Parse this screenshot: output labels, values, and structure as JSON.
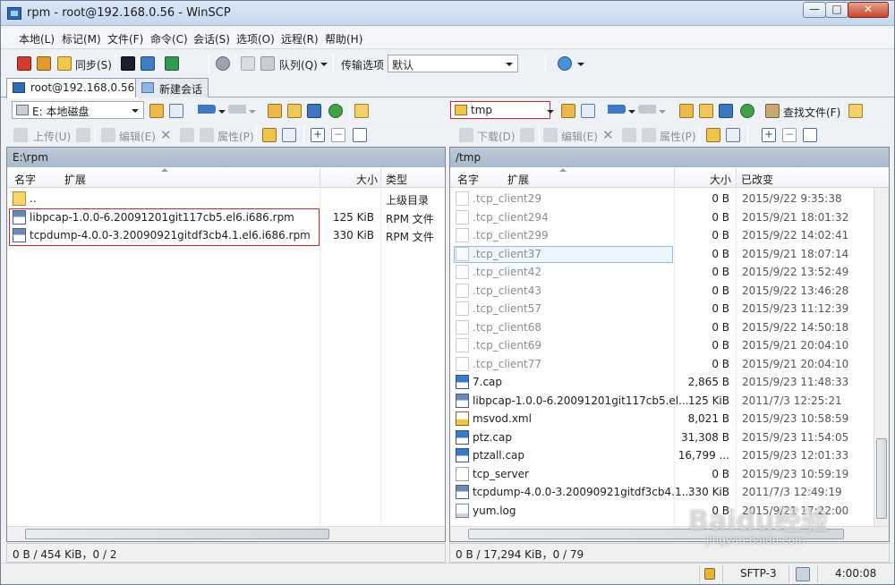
{
  "window": {
    "title": "rpm - root@192.168.0.56 - WinSCP",
    "min": "—",
    "max": "□",
    "close": "✕"
  },
  "menu": [
    "本地(L)",
    "标记(M)",
    "文件(F)",
    "命令(C)",
    "会话(S)",
    "选项(O)",
    "远程(R)",
    "帮助(H)"
  ],
  "toolbar": {
    "sync_label": "同步(S)",
    "queue_label": "队列(Q)",
    "transfer_label": "传输选项",
    "transfer_value": "默认"
  },
  "tabs": [
    {
      "label": "root@192.168.0.56",
      "active": true
    },
    {
      "label": "新建会话",
      "active": false
    }
  ],
  "local": {
    "drive": "E: 本地磁盘",
    "buttons": {
      "upload": "上传(U)",
      "edit": "编辑(E)",
      "props": "属性(P)"
    },
    "path": "E:\\rpm",
    "columns": {
      "name": "名字",
      "ext": "扩展",
      "size": "大小",
      "type": "类型"
    },
    "files": [
      {
        "icon": "up-ico",
        "name": "..",
        "size": "",
        "type": "上级目录"
      },
      {
        "icon": "rpm-ico",
        "name": "libpcap-1.0.0-6.20091201git117cb5.el6.i686.rpm",
        "size": "125 KiB",
        "type": "RPM 文件"
      },
      {
        "icon": "rpm-ico",
        "name": "tcpdump-4.0.0-3.20090921gitdf3cb4.1.el6.i686.rpm",
        "size": "330 KiB",
        "type": "RPM 文件"
      }
    ],
    "status": "0 B / 454 KiB，0 / 2"
  },
  "remote": {
    "dir": "tmp",
    "find_label": "查找文件(F)",
    "buttons": {
      "download": "下载(D)",
      "edit": "编辑(E)",
      "props": "属性(P)"
    },
    "path": "/tmp",
    "columns": {
      "name": "名字",
      "ext": "扩展",
      "size": "大小",
      "changed": "已改变"
    },
    "files": [
      {
        "icon": "file-ico",
        "name": ".tcp_client29",
        "size": "0 B",
        "changed": "2015/9/22 9:35:38",
        "hidden": true
      },
      {
        "icon": "file-ico",
        "name": ".tcp_client294",
        "size": "0 B",
        "changed": "2015/9/21 18:01:32",
        "hidden": true
      },
      {
        "icon": "file-ico",
        "name": ".tcp_client299",
        "size": "0 B",
        "changed": "2015/9/22 14:02:41",
        "hidden": true
      },
      {
        "icon": "file-ico",
        "name": ".tcp_client37",
        "size": "0 B",
        "changed": "2015/9/21 18:07:14",
        "hidden": true
      },
      {
        "icon": "file-ico",
        "name": ".tcp_client42",
        "size": "0 B",
        "changed": "2015/9/22 13:52:49",
        "hidden": true
      },
      {
        "icon": "file-ico",
        "name": ".tcp_client43",
        "size": "0 B",
        "changed": "2015/9/22 13:46:28",
        "hidden": true
      },
      {
        "icon": "file-ico",
        "name": ".tcp_client57",
        "size": "0 B",
        "changed": "2015/9/23 11:12:39",
        "hidden": true
      },
      {
        "icon": "file-ico",
        "name": ".tcp_client68",
        "size": "0 B",
        "changed": "2015/9/22 14:50:18",
        "hidden": true
      },
      {
        "icon": "file-ico",
        "name": ".tcp_client69",
        "size": "0 B",
        "changed": "2015/9/21 20:04:10",
        "hidden": true
      },
      {
        "icon": "file-ico",
        "name": ".tcp_client77",
        "size": "0 B",
        "changed": "2015/9/21 20:04:10",
        "hidden": true
      },
      {
        "icon": "cap-ico",
        "name": "7.cap",
        "size": "2,865 B",
        "changed": "2015/9/23 11:48:33",
        "hidden": false
      },
      {
        "icon": "rpm-ico",
        "name": "libpcap-1.0.0-6.20091201git117cb5.el...",
        "size": "125 KiB",
        "changed": "2011/7/3 12:25:21",
        "hidden": false
      },
      {
        "icon": "xml-ico",
        "name": "msvod.xml",
        "size": "8,021 B",
        "changed": "2015/9/23 10:58:59",
        "hidden": false
      },
      {
        "icon": "cap-ico",
        "name": "ptz.cap",
        "size": "31,308 B",
        "changed": "2015/9/23 11:54:05",
        "hidden": false
      },
      {
        "icon": "cap-ico",
        "name": "ptzall.cap",
        "size": "16,799 ...",
        "changed": "2015/9/23 12:01:33",
        "hidden": false
      },
      {
        "icon": "file-ico",
        "name": "tcp_server",
        "size": "0 B",
        "changed": "2015/9/23 10:59:19",
        "hidden": false
      },
      {
        "icon": "rpm-ico",
        "name": "tcpdump-4.0.0-3.20090921gitdf3cb4.1...",
        "size": "330 KiB",
        "changed": "2011/7/3 12:49:19",
        "hidden": false
      },
      {
        "icon": "log-ico",
        "name": "yum.log",
        "size": "0 B",
        "changed": "2015/9/21 17:22:00",
        "hidden": false
      }
    ],
    "status": "0 B / 17,294 KiB，0 / 79"
  },
  "statusbar": {
    "protocol": "SFTP-3",
    "time": "4:00:08"
  },
  "watermark": {
    "main": "Baidu经验",
    "sub": "jingyan.baidu.com"
  }
}
